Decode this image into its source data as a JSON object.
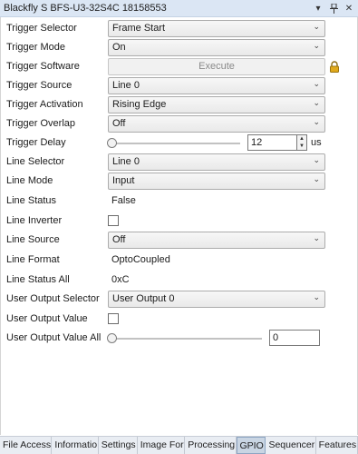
{
  "window": {
    "title": "Blackfly S BFS-U3-32S4C 18158553",
    "menu_icon": "chevron-down-icon",
    "pin_icon": "pin-icon",
    "close_icon": "close-icon"
  },
  "properties": {
    "trigger_selector": {
      "label": "Trigger Selector",
      "value": "Frame Start"
    },
    "trigger_mode": {
      "label": "Trigger Mode",
      "value": "On"
    },
    "trigger_software": {
      "label": "Trigger Software",
      "button": "Execute"
    },
    "trigger_source": {
      "label": "Trigger Source",
      "value": "Line 0"
    },
    "trigger_activation": {
      "label": "Trigger Activation",
      "value": "Rising Edge"
    },
    "trigger_overlap": {
      "label": "Trigger Overlap",
      "value": "Off"
    },
    "trigger_delay": {
      "label": "Trigger Delay",
      "value": "12",
      "unit": "us",
      "slider_fraction": 0
    },
    "line_selector": {
      "label": "Line Selector",
      "value": "Line 0"
    },
    "line_mode": {
      "label": "Line Mode",
      "value": "Input"
    },
    "line_status": {
      "label": "Line Status",
      "value": "False"
    },
    "line_inverter": {
      "label": "Line Inverter",
      "checked": false
    },
    "line_source": {
      "label": "Line Source",
      "value": "Off"
    },
    "line_format": {
      "label": "Line Format",
      "value": "OptoCoupled"
    },
    "line_status_all": {
      "label": "Line Status All",
      "value": "0xC"
    },
    "user_output_selector": {
      "label": "User Output Selector",
      "value": "User Output 0"
    },
    "user_output_value": {
      "label": "User Output Value",
      "checked": false
    },
    "user_output_value_all": {
      "label": "User Output Value All",
      "value": "0",
      "slider_fraction": 0
    }
  },
  "tabs": [
    {
      "label": "File Access",
      "active": false
    },
    {
      "label": "Informatio",
      "active": false
    },
    {
      "label": "Settings",
      "active": false
    },
    {
      "label": "Image For",
      "active": false
    },
    {
      "label": "Processing",
      "active": false
    },
    {
      "label": "GPIO",
      "active": true
    },
    {
      "label": "Sequencer",
      "active": false
    },
    {
      "label": "Features",
      "active": false
    }
  ],
  "colors": {
    "title_bar": "#dbe6f4",
    "active_tab": "#c9d5e3",
    "lock_icon": "#d4a017"
  }
}
